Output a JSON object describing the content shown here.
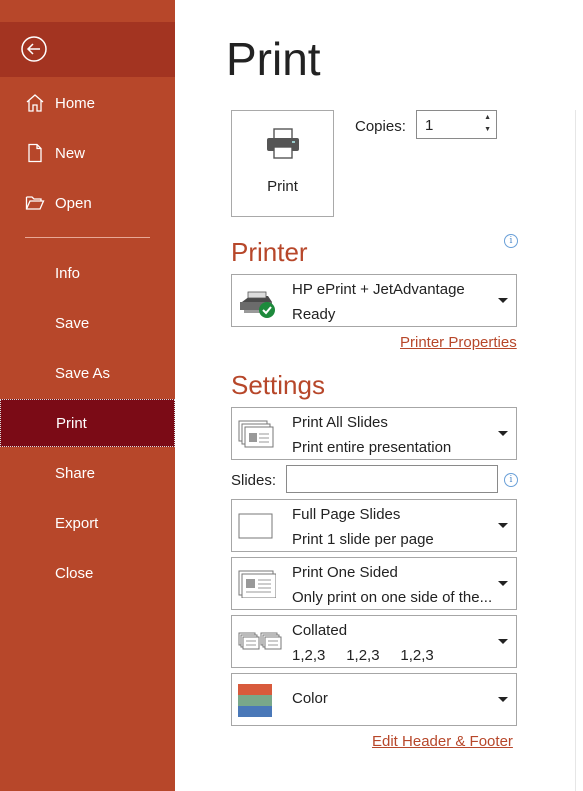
{
  "sidebar": {
    "back_icon": "back-arrow-icon",
    "items": [
      {
        "label": "Home",
        "icon": "home-icon"
      },
      {
        "label": "New",
        "icon": "new-document-icon"
      },
      {
        "label": "Open",
        "icon": "open-folder-icon"
      },
      {
        "label": "Info"
      },
      {
        "label": "Save"
      },
      {
        "label": "Save As"
      },
      {
        "label": "Print",
        "active": true
      },
      {
        "label": "Share"
      },
      {
        "label": "Export"
      },
      {
        "label": "Close"
      }
    ]
  },
  "main": {
    "title": "Print",
    "print_button_label": "Print",
    "copies_label": "Copies:",
    "copies_value": "1",
    "printer": {
      "heading": "Printer",
      "name": "HP ePrint + JetAdvantage",
      "status": "Ready",
      "properties_link": "Printer Properties"
    },
    "settings": {
      "heading": "Settings",
      "range": {
        "line1": "Print All Slides",
        "line2": "Print entire presentation"
      },
      "slides_label": "Slides:",
      "slides_value": "",
      "layout": {
        "line1": "Full Page Slides",
        "line2": "Print 1 slide per page"
      },
      "sides": {
        "line1": "Print One Sided",
        "line2": "Only print on one side of the..."
      },
      "collation": {
        "line1": "Collated",
        "line2": "1,2,3     1,2,3     1,2,3"
      },
      "color": {
        "line1": "Color"
      },
      "header_footer_link": "Edit Header & Footer"
    }
  },
  "colors": {
    "accent": "#b7472a",
    "active_nav": "#7b0b16",
    "link": "#b7472a"
  }
}
